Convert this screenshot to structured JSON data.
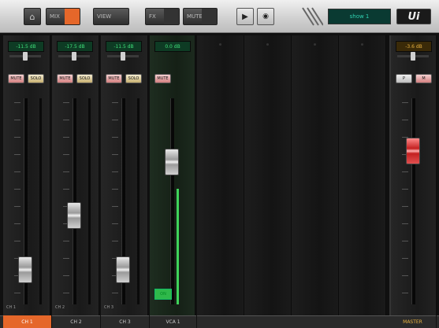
{
  "toolbar": {
    "mix_label": "MIX",
    "view_label": "VIEW",
    "fx_label": "FX",
    "mute_label": "MUTE",
    "snapshot_display": "show 1",
    "logo": "Ui"
  },
  "channels": [
    {
      "gain": "-11.5 dB",
      "mute_label": "MUTE",
      "solo_label": "SOLO",
      "group": "CH 1",
      "label": "CH 1",
      "fader_level": 0.12
    },
    {
      "gain": "-17.5 dB",
      "mute_label": "MUTE",
      "solo_label": "SOLO",
      "group": "CH 2",
      "label": "CH 2",
      "fader_level": 0.42
    },
    {
      "gain": "-11.5 dB",
      "mute_label": "MUTE",
      "solo_label": "SOLO",
      "group": "CH 3",
      "label": "CH 3",
      "fader_level": 0.12
    }
  ],
  "vca": {
    "gain": "0.0 dB",
    "mute_label": "MUTE",
    "on_label": "ON",
    "label": "VCA 1",
    "fader_level": 0.72,
    "meter_level": 0.56
  },
  "master": {
    "gain": "-3.6 dB",
    "label": "MASTER",
    "fader_level": 0.78,
    "left_btn": "P",
    "right_btn": "M"
  },
  "colors": {
    "accent": "#e5672a",
    "vca_green": "#3fd35a",
    "master_red": "#c42020"
  }
}
